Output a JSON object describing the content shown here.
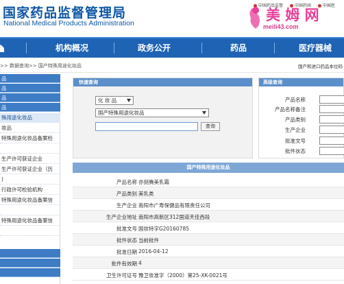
{
  "header": {
    "logo_cn": "国家药品监督管理局",
    "logo_en": "National Medical Products Administration",
    "top_links": [
      "中国药品监督",
      "中国药闻",
      "中国医"
    ],
    "watermark_title": "美 姆 网",
    "watermark_url": "meili43.com"
  },
  "nav": {
    "items": [
      "机构概况",
      "政务公开",
      "药品",
      "医疗器械"
    ]
  },
  "breadcrumb": {
    "path": ">> 数据查询>> 国产特殊用途化妆品",
    "right_text": "国产和进口药品本位码"
  },
  "sidebar": {
    "items": [
      {
        "label": "品",
        "style": "blue"
      },
      {
        "label": "品",
        "style": "blue"
      },
      {
        "label": "品",
        "style": "blue"
      },
      {
        "label": "品",
        "style": "blue"
      },
      {
        "label": "殊用途化妆品",
        "style": "active"
      },
      {
        "label": "妆品",
        "style": "plain"
      },
      {
        "label": "特殊用途化妆品备案检",
        "style": "plain"
      },
      {
        "label": "",
        "style": "plain"
      },
      {
        "label": "生产许可获证企业",
        "style": "plain"
      },
      {
        "label": "生产许可获证企业（历",
        "style": "plain"
      },
      {
        "label": ")",
        "style": "plain"
      },
      {
        "label": "行政许可检验机构",
        "style": "plain"
      },
      {
        "label": "特殊用途化妆品备案信",
        "style": "plain"
      },
      {
        "label": "",
        "style": "plain"
      },
      {
        "label": "特殊用途化妆品备案信",
        "style": "plain"
      },
      {
        "label": "",
        "style": "plain"
      },
      {
        "label": "",
        "style": "blue"
      },
      {
        "label": "",
        "style": "blue"
      },
      {
        "label": "",
        "style": "blue"
      }
    ]
  },
  "quick_query": {
    "title": "快速查询",
    "category_value": "化 妆 品",
    "database_value": "国产特殊用途化妆品",
    "search_value": "",
    "button_label": "查询"
  },
  "advanced_query": {
    "title": "高级查询",
    "fields": [
      "产品名称",
      "产品名称备注",
      "产品类别",
      "生产企业",
      "批准文号",
      "批件状态"
    ]
  },
  "result": {
    "title": "国产特殊用途化妆品",
    "rows": [
      {
        "label": "产品名称",
        "value": "亦挺腾美乳霜"
      },
      {
        "label": "产品类别",
        "value": "美乳类"
      },
      {
        "label": "生产企业",
        "value": "南阳市广寿保健品有限责任公司"
      },
      {
        "label": "生产企业地址",
        "value": "南阳市高新区312国道天佳西段"
      },
      {
        "label": "批准文号",
        "value": "国妆特字G20160785"
      },
      {
        "label": "批件状态",
        "value": "当前批件"
      },
      {
        "label": "批准日期",
        "value": "2016-04-12"
      },
      {
        "label": "批件有效期",
        "value": "4"
      },
      {
        "label": "卫生许可证号",
        "value": "豫卫妆准字（2000）第25-XK-0021号"
      }
    ]
  },
  "colors": {
    "brand_blue": "#0e57a5",
    "nav_blue": "#1e63b4",
    "panel_header": "#5b8fc9",
    "watermark_pink": "#e8409a"
  }
}
